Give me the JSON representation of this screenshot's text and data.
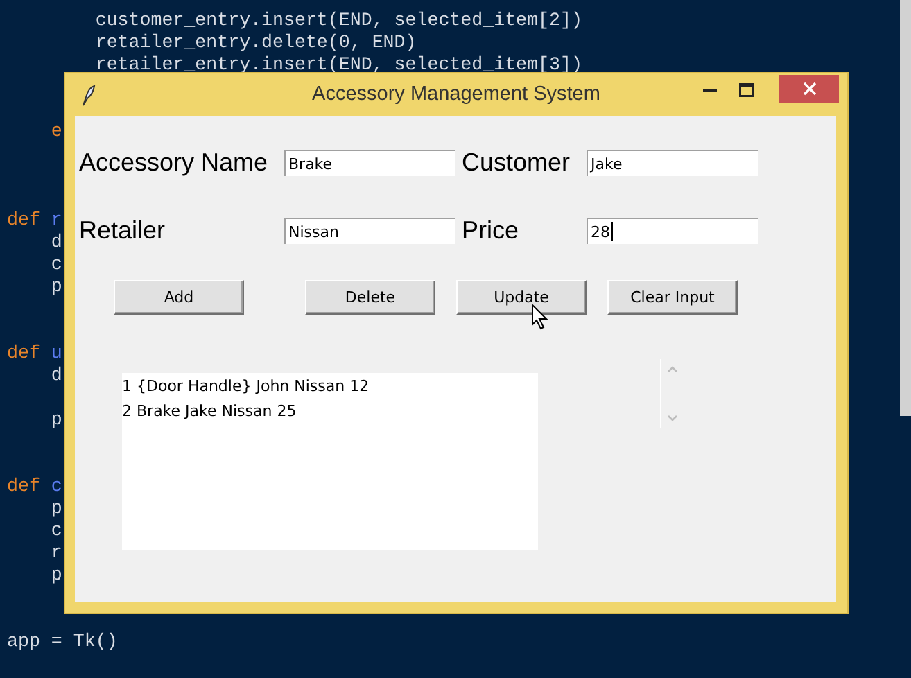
{
  "editor": {
    "lines": [
      {
        "kind": "gap"
      },
      {
        "tokens": [
          {
            "text": "        customer_entry.insert(END, selected_item[2])",
            "kind": "plain"
          }
        ]
      },
      {
        "tokens": [
          {
            "text": "        retailer_entry.delete(0, END)",
            "kind": "plain"
          }
        ]
      },
      {
        "tokens": [
          {
            "text": "        retailer_entry.insert(END, selected_item[3])",
            "kind": "plain"
          }
        ]
      },
      {
        "kind": "gap"
      },
      {
        "kind": "gap"
      },
      {
        "tokens": [
          {
            "text": "    e",
            "kind": "keyword"
          }
        ]
      },
      {
        "kind": "gap"
      },
      {
        "kind": "gap"
      },
      {
        "kind": "gap"
      },
      {
        "tokens": [
          {
            "text": "def",
            "kind": "keyword"
          },
          {
            "text": " r",
            "kind": "name"
          }
        ]
      },
      {
        "tokens": [
          {
            "text": "    d",
            "kind": "plain"
          }
        ]
      },
      {
        "tokens": [
          {
            "text": "    c",
            "kind": "plain"
          }
        ]
      },
      {
        "tokens": [
          {
            "text": "    p",
            "kind": "plain"
          }
        ]
      },
      {
        "kind": "gap"
      },
      {
        "kind": "gap"
      },
      {
        "tokens": [
          {
            "text": "def",
            "kind": "keyword"
          },
          {
            "text": " u",
            "kind": "name"
          }
        ]
      },
      {
        "tokens": [
          {
            "text": "    d",
            "kind": "plain"
          }
        ]
      },
      {
        "kind": "gap"
      },
      {
        "tokens": [
          {
            "text": "    p",
            "kind": "plain"
          }
        ]
      },
      {
        "kind": "gap"
      },
      {
        "kind": "gap"
      },
      {
        "tokens": [
          {
            "text": "def",
            "kind": "keyword"
          },
          {
            "text": " c",
            "kind": "name"
          }
        ]
      },
      {
        "tokens": [
          {
            "text": "    p",
            "kind": "plain"
          }
        ]
      },
      {
        "tokens": [
          {
            "text": "    c",
            "kind": "plain"
          }
        ]
      },
      {
        "tokens": [
          {
            "text": "    r",
            "kind": "plain"
          }
        ]
      },
      {
        "tokens": [
          {
            "text": "    p",
            "kind": "plain"
          }
        ]
      },
      {
        "kind": "gap"
      },
      {
        "kind": "gap"
      },
      {
        "tokens": [
          {
            "text": "app = Tk()",
            "kind": "plain"
          }
        ]
      }
    ]
  },
  "window": {
    "title": "Accessory Management System",
    "fields": [
      {
        "label": "Accessory Name",
        "value": "Brake",
        "focused": false
      },
      {
        "label": "Customer",
        "value": "Jake",
        "focused": false
      },
      {
        "label": "Retailer",
        "value": "Nissan",
        "focused": false
      },
      {
        "label": "Price",
        "value": "28",
        "focused": true
      }
    ],
    "buttons": [
      {
        "label": "Add"
      },
      {
        "label": "Delete"
      },
      {
        "label": "Update"
      },
      {
        "label": "Clear Input"
      }
    ],
    "listbox": {
      "items": [
        "1 {Door Handle} John Nissan 12",
        "2 Brake Jake Nissan 25"
      ]
    }
  }
}
